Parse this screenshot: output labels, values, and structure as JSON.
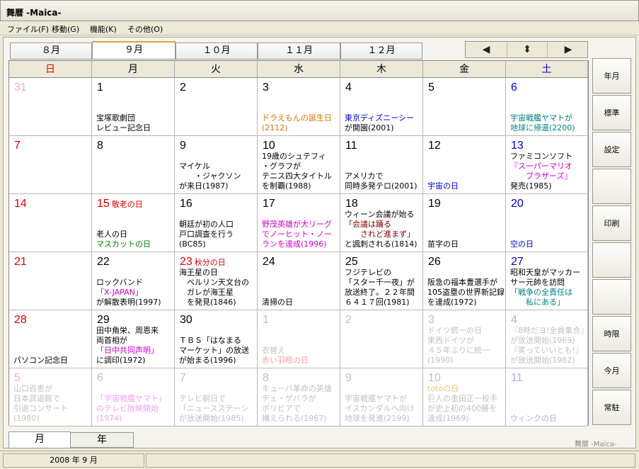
{
  "app": {
    "title": "舞暦 -Maica-",
    "brand": "舞暦 -Maica-"
  },
  "menu": [
    "ファイル(F)",
    "移動(G)",
    "機能(K)",
    "その他(O)"
  ],
  "month_tabs": [
    {
      "label": "８月",
      "active": false
    },
    {
      "label": "９月",
      "active": true
    },
    {
      "label": "１０月",
      "active": false
    },
    {
      "label": "１１月",
      "active": false
    },
    {
      "label": "１２月",
      "active": false
    }
  ],
  "nav": {
    "prev": "◀",
    "mid": "⬍",
    "next": "▶"
  },
  "weekdays": [
    {
      "label": "日",
      "color": "#dd0000"
    },
    {
      "label": "月",
      "color": "#000000"
    },
    {
      "label": "火",
      "color": "#000000"
    },
    {
      "label": "水",
      "color": "#000000"
    },
    {
      "label": "木",
      "color": "#000000"
    },
    {
      "label": "金",
      "color": "#000000"
    },
    {
      "label": "土",
      "color": "#0000cc"
    }
  ],
  "colors": {
    "sun": "#dd0000",
    "sat": "#0000cc",
    "normal": "#000000",
    "faded": "#c0c0c0",
    "faded_sun": "#f0b0b0",
    "faded_sat": "#b0b0e0"
  },
  "cells": [
    {
      "day": "31",
      "kind": "faded_sun",
      "events": []
    },
    {
      "day": "1",
      "kind": "normal",
      "events": [
        {
          "t": "宝塚歌劇団",
          "c": "#000"
        },
        {
          "t": "レビュー記念日",
          "c": "#000"
        }
      ]
    },
    {
      "day": "2",
      "kind": "normal",
      "events": []
    },
    {
      "day": "3",
      "kind": "normal",
      "events": [
        {
          "t": "ドラえもんの誕生日",
          "c": "#e07000"
        },
        {
          "t": "(2112)",
          "c": "#e07000"
        }
      ]
    },
    {
      "day": "4",
      "kind": "normal",
      "events": [
        {
          "t": "東京ディズニーシー",
          "c": "#0000cc"
        },
        {
          "t": "が開園(2001)",
          "c": "#000"
        }
      ]
    },
    {
      "day": "5",
      "kind": "normal",
      "events": []
    },
    {
      "day": "6",
      "kind": "sat",
      "events": [
        {
          "t": "宇宙戦艦ヤマトが",
          "c": "#008080"
        },
        {
          "t": "地球に帰還(2200)",
          "c": "#008080"
        }
      ]
    },
    {
      "day": "7",
      "kind": "sun",
      "events": []
    },
    {
      "day": "8",
      "kind": "normal",
      "events": []
    },
    {
      "day": "9",
      "kind": "normal",
      "events": [
        {
          "t": "マイケル",
          "c": "#000"
        },
        {
          "t": "　　・ジャクソン",
          "c": "#000"
        },
        {
          "t": "が来日(1987)",
          "c": "#000"
        }
      ]
    },
    {
      "day": "10",
      "kind": "normal",
      "events": [
        {
          "t": "19歳のシュテフィ",
          "c": "#000"
        },
        {
          "t": "・グラフが",
          "c": "#000"
        },
        {
          "t": "テニス四大タイトル",
          "c": "#000"
        },
        {
          "t": "を制覇(1988)",
          "c": "#000"
        }
      ]
    },
    {
      "day": "11",
      "kind": "normal",
      "events": [
        {
          "t": "アメリカで",
          "c": "#000"
        },
        {
          "t": "同時多発テロ(2001)",
          "c": "#000"
        }
      ]
    },
    {
      "day": "12",
      "kind": "normal",
      "events": [
        {
          "t": "宇宙の日",
          "c": "#0000cc"
        }
      ]
    },
    {
      "day": "13",
      "kind": "sat",
      "events": [
        {
          "t": "ファミコンソフト",
          "c": "#000"
        },
        {
          "t": "『スーパーマリオ",
          "c": "#cc00cc"
        },
        {
          "t": "　　ブラザーズ』",
          "c": "#cc00cc"
        },
        {
          "t": "発売(1985)",
          "c": "#000"
        }
      ]
    },
    {
      "day": "14",
      "kind": "sun",
      "events": []
    },
    {
      "day": "15",
      "kind": "sun",
      "holiday": "敬老の日",
      "events": [
        {
          "t": "老人の日",
          "c": "#000"
        },
        {
          "t": "マスカットの日",
          "c": "#008000"
        }
      ]
    },
    {
      "day": "16",
      "kind": "normal",
      "events": [
        {
          "t": "朝廷が初の人口",
          "c": "#000"
        },
        {
          "t": "戸口調査を行う",
          "c": "#000"
        },
        {
          "t": "(BC85)",
          "c": "#000"
        }
      ]
    },
    {
      "day": "17",
      "kind": "normal",
      "events": [
        {
          "t": "野茂英雄が大リーグ",
          "c": "#cc00cc"
        },
        {
          "t": "でノーヒット・ノー",
          "c": "#cc00cc"
        },
        {
          "t": "ランを達成(1996)",
          "c": "#cc00cc"
        }
      ]
    },
    {
      "day": "18",
      "kind": "normal",
      "events": [
        {
          "t": "ウィーン会議が始る",
          "c": "#000"
        },
        {
          "t": "「会議は踊る",
          "c": "#800000"
        },
        {
          "t": "　　されど進まず」",
          "c": "#800000"
        },
        {
          "t": "と諷刺される(1814)",
          "c": "#000"
        }
      ]
    },
    {
      "day": "19",
      "kind": "normal",
      "events": [
        {
          "t": "苗字の日",
          "c": "#000"
        }
      ]
    },
    {
      "day": "20",
      "kind": "sat",
      "events": [
        {
          "t": "空の日",
          "c": "#0000cc"
        }
      ]
    },
    {
      "day": "21",
      "kind": "sun",
      "events": []
    },
    {
      "day": "22",
      "kind": "normal",
      "events": [
        {
          "t": "ロックバンド",
          "c": "#000"
        },
        {
          "t": "「X-JAPAN」",
          "c": "#cc00cc"
        },
        {
          "t": "が解散表明(1997)",
          "c": "#000"
        }
      ]
    },
    {
      "day": "23",
      "kind": "sun",
      "holiday": "秋分の日",
      "events": [
        {
          "t": "海王星の日",
          "c": "#000"
        },
        {
          "t": "　ベルリン天文台の",
          "c": "#000"
        },
        {
          "t": "　ガレが海王星",
          "c": "#000"
        },
        {
          "t": "　を発見(1846)",
          "c": "#000"
        }
      ]
    },
    {
      "day": "24",
      "kind": "normal",
      "events": [
        {
          "t": "清掃の日",
          "c": "#000"
        }
      ]
    },
    {
      "day": "25",
      "kind": "normal",
      "events": [
        {
          "t": "フジテレビの",
          "c": "#000"
        },
        {
          "t": "「スター千一夜」が",
          "c": "#000"
        },
        {
          "t": "放送終了。２２年間",
          "c": "#000"
        },
        {
          "t": "６４１７回(1981)",
          "c": "#000"
        }
      ]
    },
    {
      "day": "26",
      "kind": "normal",
      "events": [
        {
          "t": "阪急の福本豊選手が",
          "c": "#000"
        },
        {
          "t": "105盗塁の世界新記録",
          "c": "#000"
        },
        {
          "t": "を達成(1972)",
          "c": "#000"
        }
      ]
    },
    {
      "day": "27",
      "kind": "sat",
      "events": [
        {
          "t": "昭和天皇がマッカー",
          "c": "#000"
        },
        {
          "t": "サー元帥を訪問",
          "c": "#000"
        },
        {
          "t": "「戦争の全責任は",
          "c": "#008080"
        },
        {
          "t": "　　私にある」",
          "c": "#008080"
        }
      ]
    },
    {
      "day": "28",
      "kind": "sun",
      "events": [
        {
          "t": "パソコン記念日",
          "c": "#000"
        }
      ]
    },
    {
      "day": "29",
      "kind": "normal",
      "events": [
        {
          "t": "田中角栄、周恩来",
          "c": "#000"
        },
        {
          "t": "両首相が",
          "c": "#000"
        },
        {
          "t": "「日中共同声明」",
          "c": "#cc00cc"
        },
        {
          "t": "に調印(1972)",
          "c": "#000"
        }
      ]
    },
    {
      "day": "30",
      "kind": "normal",
      "events": [
        {
          "t": "ＴＢＳ「はなまる",
          "c": "#000"
        },
        {
          "t": "マーケット」の放送",
          "c": "#000"
        },
        {
          "t": "が始まる(1996)",
          "c": "#000"
        }
      ]
    },
    {
      "day": "1",
      "kind": "faded",
      "events": [
        {
          "t": "衣替え",
          "c": "#c0c0c0"
        },
        {
          "t": "赤い羽根の日",
          "c": "#f0a0a0"
        }
      ]
    },
    {
      "day": "2",
      "kind": "faded",
      "events": []
    },
    {
      "day": "3",
      "kind": "faded",
      "events": [
        {
          "t": "ドイツ統一の日",
          "c": "#c0c0c0"
        },
        {
          "t": "東西ドイツが",
          "c": "#c0c0c0"
        },
        {
          "t": "４５年ぶりに統一",
          "c": "#c0c0c0"
        },
        {
          "t": "(1990)",
          "c": "#c0c0c0"
        }
      ]
    },
    {
      "day": "4",
      "kind": "faded_sat",
      "events": [
        {
          "t": "『8時だヨ!全員集合』",
          "c": "#c0c0c0"
        },
        {
          "t": "が放送開始(1969)",
          "c": "#c0c0c0"
        },
        {
          "t": "『笑っていいとも!』",
          "c": "#c0c0c0"
        },
        {
          "t": "が放送開始(1982)",
          "c": "#c0c0c0"
        }
      ]
    },
    {
      "day": "5",
      "kind": "faded_sun",
      "events": [
        {
          "t": "山口百恵が",
          "c": "#c0c0c0"
        },
        {
          "t": "日本武道館で",
          "c": "#c0c0c0"
        },
        {
          "t": "引退コンサート",
          "c": "#c0c0c0"
        },
        {
          "t": "(1980)",
          "c": "#c0c0c0"
        }
      ]
    },
    {
      "day": "6",
      "kind": "faded",
      "events": [
        {
          "t": "「宇宙戦艦ヤマト」",
          "c": "#f0a0f0"
        },
        {
          "t": "のテレビ放映開始",
          "c": "#f0a0f0"
        },
        {
          "t": "(1974)",
          "c": "#f0a0f0"
        }
      ]
    },
    {
      "day": "7",
      "kind": "faded",
      "events": [
        {
          "t": "テレビ朝日で",
          "c": "#c0c0c0"
        },
        {
          "t": "「ニュースステーシ",
          "c": "#c0c0c0"
        },
        {
          "t": "が放送開始(1985)",
          "c": "#c0c0c0"
        }
      ]
    },
    {
      "day": "8",
      "kind": "faded",
      "events": [
        {
          "t": "キューバ革命の英雄",
          "c": "#c0c0c0"
        },
        {
          "t": "チェ・ゲバラが",
          "c": "#c0c0c0"
        },
        {
          "t": "ボリビアで",
          "c": "#c0c0c0"
        },
        {
          "t": "捕えられる(1967)",
          "c": "#c0c0c0"
        }
      ]
    },
    {
      "day": "9",
      "kind": "faded",
      "events": [
        {
          "t": "宇宙戦艦ヤマトが",
          "c": "#c0c0c0"
        },
        {
          "t": "イスカンダルへ向け",
          "c": "#c0c0c0"
        },
        {
          "t": "地球を発進(2199)",
          "c": "#c0c0c0"
        }
      ]
    },
    {
      "day": "10",
      "kind": "faded",
      "events": [
        {
          "t": "totoの日",
          "c": "#f0c080"
        },
        {
          "t": "巨人の金田正一投手",
          "c": "#c0c0c0"
        },
        {
          "t": "が史上初の400勝を",
          "c": "#c0c0c0"
        },
        {
          "t": "達成(1969)",
          "c": "#c0c0c0"
        }
      ]
    },
    {
      "day": "11",
      "kind": "faded_sat",
      "events": [
        {
          "t": "ウィンクの日",
          "c": "#b0b0e0"
        }
      ]
    }
  ],
  "side_buttons": [
    "年月",
    "標準",
    "設定",
    "",
    "印刷",
    "",
    "",
    "時限",
    "今月",
    "常駐"
  ],
  "bottom_tabs": [
    {
      "label": "月",
      "active": true
    },
    {
      "label": "年",
      "active": false
    }
  ],
  "status": {
    "date": "2008 年 9 月"
  }
}
